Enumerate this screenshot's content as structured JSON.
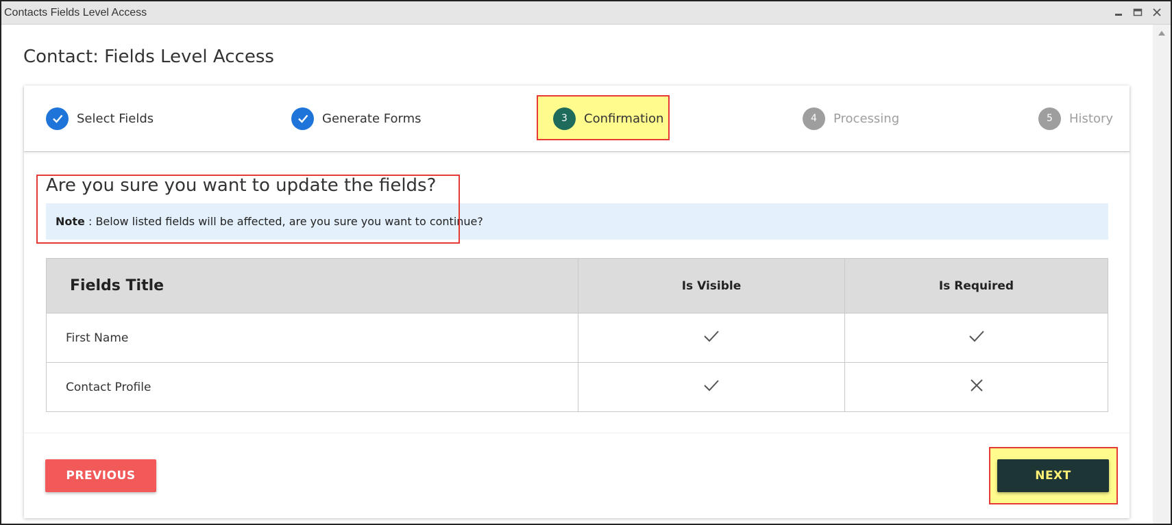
{
  "window": {
    "title": "Contacts Fields Level Access"
  },
  "page": {
    "title": "Contact: Fields Level Access"
  },
  "stepper": {
    "steps": [
      {
        "number": "1",
        "label": "Select Fields",
        "status": "done"
      },
      {
        "number": "2",
        "label": "Generate Forms",
        "status": "done"
      },
      {
        "number": "3",
        "label": "Confirmation",
        "status": "active"
      },
      {
        "number": "4",
        "label": "Processing",
        "status": "pending"
      },
      {
        "number": "5",
        "label": "History",
        "status": "pending"
      }
    ]
  },
  "confirmation": {
    "question": "Are you sure you want to update the fields?",
    "note_label": "Note",
    "note_text": " : Below listed fields will be affected, are you sure you want to continue?"
  },
  "table": {
    "headers": [
      "Fields Title",
      "Is Visible",
      "Is Required"
    ],
    "rows": [
      {
        "title": "First Name",
        "visible": "check-icon",
        "required": "check-icon"
      },
      {
        "title": "Contact Profile",
        "visible": "check-icon",
        "required": "cross-icon"
      }
    ]
  },
  "footer": {
    "previous_label": "PREVIOUS",
    "next_label": "NEXT"
  },
  "colors": {
    "done": "#1e74d8",
    "active": "#1e6b5c",
    "pending": "#9e9e9e",
    "highlight": "#fffb8c",
    "highlight_border": "#e53935",
    "previous_button": "#f25a5a",
    "next_button": "#1d3535",
    "note_background": "#e4f1fd"
  }
}
